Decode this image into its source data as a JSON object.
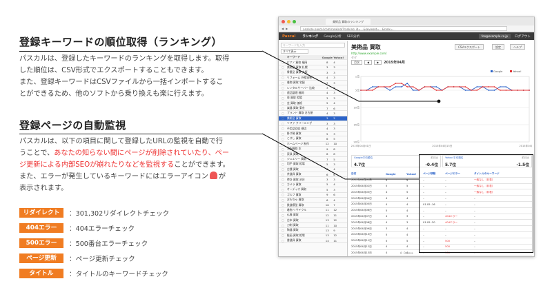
{
  "section1": {
    "title": "登録キーワードの順位取得（ランキング）",
    "lines": [
      "パスカルは、登録したキーワードのランキングを取得します。取得",
      "した順位は、CSV形式でエクスポートすることもできます。",
      "また、登録キーワードはCSVファイルから一括インポートするこ",
      "とができるため、他のソフトから乗り換えも楽に行えます。"
    ]
  },
  "section2": {
    "title": "登録ページの自動監視",
    "line1": "パスカルは、以下の項目に関して登録したURLの監視を自動で行",
    "line2_a": "うことで、",
    "line2_red": "あなたの知らない間にページが削除されていたり、ペー",
    "line3_red": "ジ更新による内部SEOが崩れたりなどを監視する",
    "line3_b": "ことができます。",
    "line4_a": "また、エラーが発生しているキーワードにはエラーアイコン",
    "line4_b": "が",
    "line5": "表示されます。"
  },
  "features": [
    {
      "label": "リダイレクト",
      "desc": "：301,302リダイレクトチェック"
    },
    {
      "label": "404エラー",
      "desc": "：404エラーチェック"
    },
    {
      "label": "500エラー",
      "desc": "：500番台エラーチェック"
    },
    {
      "label": "ページ更新",
      "desc": "：ページ更新チェック"
    },
    {
      "label": "タイトル",
      "desc": "：タイトルのキーワードチェック"
    }
  ],
  "browser": {
    "tab_title": "美術品 買取のランキング",
    "url": "analyze.pascal.com/ranking/?ranking_id=...&keyword=...&rank=...",
    "app": {
      "logo": "Pascal",
      "nav": [
        "ランキング",
        "Google分析",
        "SEO分析"
      ],
      "email": "foo@example.co.jp",
      "logout": "ログアウト"
    },
    "keyword_panel": {
      "search_placeholder": "キーワードを入力",
      "filter": "すべて表示",
      "headers": [
        "キーワード",
        "Google",
        "Yahoo!"
      ],
      "rows": [
        {
          "kw": "ピアノ 買取 福岡",
          "g": "8",
          "y": "4",
          "gc": "",
          "yc": ""
        },
        {
          "kw": "美術品 買取 札幌",
          "g": "3",
          "y": "3",
          "gc": "",
          "yc": ""
        },
        {
          "kw": "骨董品 買取 大阪",
          "g": "3",
          "y": "3",
          "gc": "",
          "yc": ""
        },
        {
          "kw": "リフォーム 外壁塗装",
          "g": "4",
          "y": "3",
          "gc": "",
          "yc": ""
        },
        {
          "kw": "着物 買取 宅配",
          "g": "3",
          "y": "3",
          "gc": "",
          "yc": ""
        },
        {
          "kw": "レンタルサーバー 比較",
          "g": "3",
          "y": "3",
          "gc": "",
          "yc": ""
        },
        {
          "kw": "遺品整理 福岡",
          "g": "4",
          "y": "3",
          "gc": "",
          "yc": ""
        },
        {
          "kw": "車 買取 相場",
          "g": "3",
          "y": "3",
          "gc": "",
          "yc": ""
        },
        {
          "kw": "金 買取 価格",
          "g": "5",
          "y": "4",
          "gc": "",
          "yc": ""
        },
        {
          "kw": "楽器 買取 東京",
          "g": "7",
          "y": "6",
          "gc": "",
          "yc": ""
        },
        {
          "kw": "ブランド 買取 名古屋",
          "g": "4",
          "y": "3",
          "gc": "",
          "yc": ""
        },
        {
          "kw": "美術品 買取",
          "g": "3",
          "y": "2",
          "gc": "",
          "yc": "",
          "selected": true
        },
        {
          "kw": "ソファ クリーニング",
          "g": "3",
          "y": "3",
          "gc": "",
          "yc": ""
        },
        {
          "kw": "不用品回収 横浜",
          "g": "4",
          "y": "3",
          "gc": "",
          "yc": ""
        },
        {
          "kw": "掛け軸 買取",
          "g": "5",
          "y": "3",
          "gc": "",
          "yc": ""
        },
        {
          "kw": "こけし 買取",
          "g": "6",
          "y": "5",
          "gc": "",
          "yc": ""
        },
        {
          "kw": "ホームページ 制作",
          "g": "12",
          "y": "10",
          "gc": "",
          "yc": ""
        },
        {
          "kw": "宅配買取 本",
          "g": "9",
          "y": "8",
          "gc": "",
          "yc": ""
        },
        {
          "kw": "家具 買取",
          "g": "8",
          "y": "8",
          "gc": "",
          "yc": ""
        },
        {
          "kw": "ジュエリー 買取",
          "g": "7",
          "y": "5",
          "gc": "",
          "yc": ""
        },
        {
          "kw": "切手 買取 相場",
          "g": "5",
          "y": "3",
          "gc": "",
          "yc": ""
        },
        {
          "kw": "古銭 買取",
          "g": "6",
          "y": "4",
          "gc": "",
          "yc": ""
        },
        {
          "kw": "茶道具 買取",
          "g": "6",
          "y": "6",
          "gc": "",
          "yc": ""
        },
        {
          "kw": "時計 買取 渋谷",
          "g": "3",
          "y": "3",
          "gc": "",
          "yc": ""
        },
        {
          "kw": "カメラ 買取",
          "g": "5",
          "y": "4",
          "gc": "",
          "yc": ""
        },
        {
          "kw": "オーディオ 買取",
          "g": "5",
          "y": "3",
          "gc": "",
          "yc": ""
        },
        {
          "kw": "ゴルフ 買取",
          "g": "9",
          "y": "6",
          "gc": "",
          "yc": ""
        },
        {
          "kw": "おもちゃ 買取",
          "g": "6",
          "y": "4",
          "gc": "",
          "yc": ""
        },
        {
          "kw": "鉄道模型 買取",
          "g": "10",
          "y": "7",
          "gc": "",
          "yc": ""
        },
        {
          "kw": "着物 リサイクル",
          "g": "11",
          "y": "12",
          "gc": "",
          "yc": ""
        },
        {
          "kw": "仏像 買取",
          "g": "12",
          "y": "11",
          "gc": "",
          "yc": ""
        },
        {
          "kw": "古本 買取",
          "g": "13",
          "y": "12",
          "gc": "",
          "yc": ""
        },
        {
          "kw": "刀剣 買取",
          "g": "11",
          "y": "10",
          "gc": "",
          "yc": ""
        },
        {
          "kw": "陶器 買取",
          "g": "13",
          "y": "9",
          "gc": "",
          "yc": ""
        },
        {
          "kw": "絵画 買取 相場",
          "g": "13",
          "y": "12",
          "gc": "",
          "yc": ""
        },
        {
          "kw": "書道具 買取",
          "g": "14",
          "y": "11",
          "gc": "",
          "yc": ""
        }
      ]
    },
    "main": {
      "title": "美術品 買取",
      "url": "http://www.example.com/",
      "tag": "タグ",
      "btn_csv": "CSVエクスポート",
      "btn_settings": "設定",
      "btn_help": "ヘルプ",
      "period": "月次",
      "month": "2015年04月",
      "cards": [
        {
          "label": "Google平均順位",
          "value": "4.7位",
          "sub_label": "前月比",
          "sub_value": "-0.4位"
        },
        {
          "label": "Yahoo!平均順位",
          "value": "5.7位",
          "sub_label": "前月比",
          "sub_value": "-1.5位"
        }
      ],
      "table_headers": [
        "日付",
        "Google",
        "Yahoo!",
        "ページ移動",
        "ページエラー",
        "タイトルのキーワード"
      ],
      "table_rows": [
        [
          "2015年04月01日",
          "5",
          "5",
          "–",
          "–",
          "一致なし（非表）"
        ],
        [
          "2015年04月02日",
          "5",
          "5",
          "–",
          "–",
          "一致なし（非表）"
        ],
        [
          "2015年04月03日",
          "4",
          "5",
          "–",
          "–",
          "一致なし（非表）"
        ],
        [
          "2015年04月04日",
          "4",
          "4",
          "–",
          "–",
          "–"
        ],
        [
          "2015年04月05日",
          "4",
          "4",
          "01.05 .16",
          "–",
          "–"
        ],
        [
          "2015年04月06日",
          "5",
          "4",
          "–",
          "–",
          "–"
        ],
        [
          "2015年04月07日",
          "4",
          "3",
          "–",
          "404エラー",
          "–"
        ],
        [
          "2015年04月08日",
          "4",
          "3",
          "01.05 .20",
          "404エラー",
          "–"
        ],
        [
          "2015年04月09日",
          "3",
          "4",
          "–",
          "–",
          "–"
        ],
        [
          "2015年04月10日",
          "5",
          "4",
          "–",
          "–",
          "–"
        ],
        [
          "2015年04月11日",
          "5",
          "5",
          "–",
          "500",
          "–"
        ],
        [
          "2015年04月12日",
          "4",
          "4",
          "–",
          "500",
          "–"
        ],
        [
          "2015年04月13日",
          "4",
          "4",
          "–",
          "500",
          "–"
        ],
        [
          "2015年04月14日",
          "4",
          "5",
          "–",
          "–",
          "–"
        ]
      ],
      "copyright": "© Ohtora"
    }
  },
  "chart_data": {
    "type": "line",
    "title": "2015年04月",
    "legend": [
      "Google",
      "Yahoo!"
    ],
    "legend_position": "top-right",
    "x": [
      "04/01",
      "04/02",
      "04/03",
      "04/04",
      "04/05",
      "04/06",
      "04/07",
      "04/08",
      "04/09",
      "04/10",
      "04/11",
      "04/12",
      "04/13",
      "04/14",
      "04/15",
      "04/16",
      "04/17",
      "04/18",
      "04/19",
      "04/20",
      "04/21",
      "04/22",
      "04/23",
      "04/24",
      "04/25",
      "04/26",
      "04/27",
      "04/28",
      "04/29",
      "04/30"
    ],
    "series": [
      {
        "name": "Google",
        "color": "#2a62c8",
        "values": [
          5,
          5,
          4,
          4,
          4,
          5,
          4,
          4,
          3,
          5,
          5,
          4,
          4,
          4,
          5,
          4,
          4,
          4,
          5,
          5,
          4,
          4,
          5,
          5,
          4,
          4,
          5,
          5,
          5,
          5
        ]
      },
      {
        "name": "Yahoo!",
        "color": "#e33333",
        "values": [
          5,
          5,
          5,
          4,
          4,
          4,
          3,
          3,
          4,
          4,
          5,
          4,
          4,
          5,
          5,
          4,
          4,
          4,
          4,
          5,
          5,
          4,
          4,
          4,
          5,
          5,
          5,
          5,
          5,
          5
        ]
      }
    ],
    "ylim": [
      1,
      20
    ],
    "y_inverted": true,
    "yticks": [
      "1位",
      "5位",
      "10位",
      "15位",
      "20位"
    ],
    "xticks": [
      "2015年04月01日",
      "2015年04月15日",
      "2015年04月30日"
    ],
    "grid": true
  },
  "colors": {
    "badge": "#f07c22",
    "accent_red": "#e33333",
    "link_blue": "#2a62c8",
    "appbar": "#3b3b3b"
  }
}
